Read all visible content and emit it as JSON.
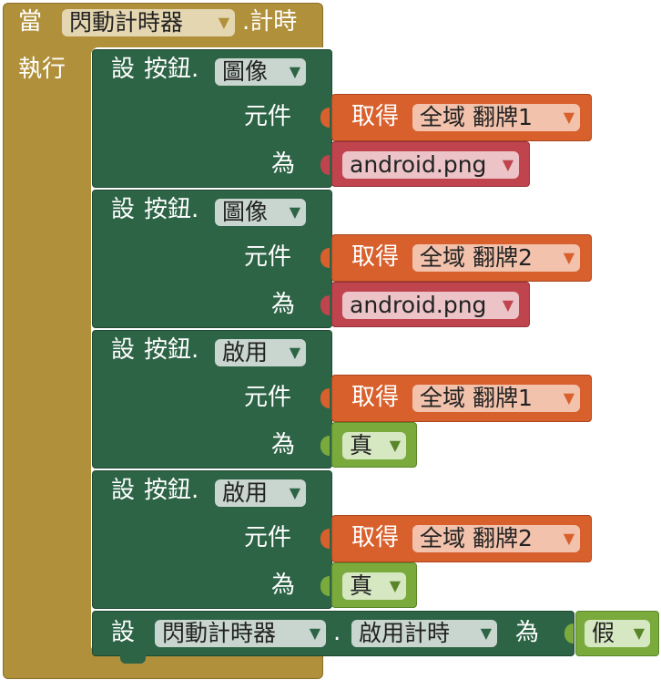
{
  "event": {
    "when_label": "當",
    "component": "閃動計時器",
    "event_name": ".計時",
    "do_label": "執行"
  },
  "set_label": "設",
  "button_label": "按鈕.",
  "component_label": "元件",
  "to_label": "為",
  "get_label": "取得",
  "statements": [
    {
      "property": "圖像",
      "variable": "全域 翻牌1",
      "value": "android.png"
    },
    {
      "property": "圖像",
      "variable": "全域 翻牌2",
      "value": "android.png"
    },
    {
      "property": "啟用",
      "variable": "全域 翻牌1",
      "value": "真"
    },
    {
      "property": "啟用",
      "variable": "全域 翻牌2",
      "value": "真"
    }
  ],
  "final": {
    "component": "閃動計時器",
    "dot": ".",
    "property": "啟用計時",
    "value": "假"
  },
  "arrow_glyph": "▼",
  "colors": {
    "event": "#b0903a",
    "setter": "#2d6446",
    "getter": "#d8602d",
    "text": "#c0444e",
    "boolean": "#7aaa3c"
  }
}
